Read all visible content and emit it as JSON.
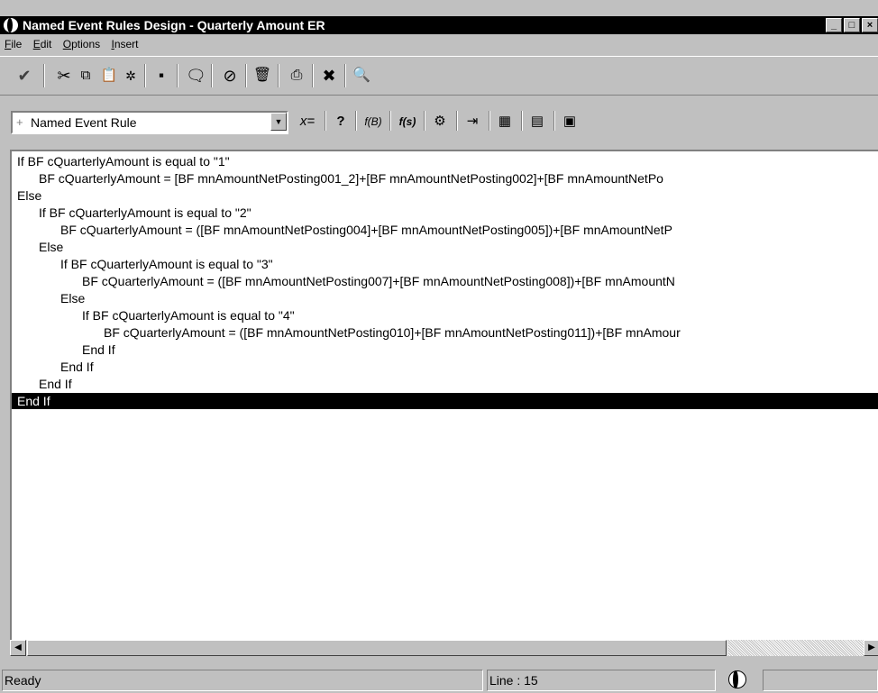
{
  "window": {
    "title": "Named Event Rules Design - Quarterly Amount ER"
  },
  "menu": {
    "items": [
      {
        "key": "F",
        "rest": "ile"
      },
      {
        "key": "E",
        "rest": "dit"
      },
      {
        "key": "O",
        "rest": "ptions"
      },
      {
        "key": "I",
        "rest": "nsert"
      }
    ]
  },
  "toolbar": {
    "icons": [
      "checkmark-icon",
      "cut-icon",
      "copy-icon",
      "paste-icon",
      "find-replace-icon",
      "save-icon",
      "comment-icon",
      "cancel-icon",
      "delete-icon",
      "print-icon",
      "close-icon",
      "validate-icon"
    ]
  },
  "er_toolbar": {
    "selector_value": "Named Event Rule",
    "selector_prefix": "+",
    "assignment_label": "x=",
    "if_label": "?",
    "function_b_label": "f(B)",
    "function_s_label": "f(s)"
  },
  "editor": {
    "lines": [
      {
        "indent": 0,
        "text": "If BF cQuarterlyAmount is equal to \"1\"",
        "selected": false
      },
      {
        "indent": 1,
        "text": "BF cQuarterlyAmount = [BF mnAmountNetPosting001_2]+[BF mnAmountNetPosting002]+[BF mnAmountNetPo",
        "selected": false
      },
      {
        "indent": 0,
        "text": "Else",
        "selected": false
      },
      {
        "indent": 1,
        "text": "If BF cQuarterlyAmount is equal to \"2\"",
        "selected": false
      },
      {
        "indent": 2,
        "text": "BF cQuarterlyAmount = ([BF mnAmountNetPosting004]+[BF mnAmountNetPosting005])+[BF mnAmountNetP",
        "selected": false
      },
      {
        "indent": 1,
        "text": "Else",
        "selected": false
      },
      {
        "indent": 2,
        "text": "If BF cQuarterlyAmount is equal to \"3\"",
        "selected": false
      },
      {
        "indent": 3,
        "text": "BF cQuarterlyAmount = ([BF mnAmountNetPosting007]+[BF mnAmountNetPosting008])+[BF mnAmountN",
        "selected": false
      },
      {
        "indent": 2,
        "text": "Else",
        "selected": false
      },
      {
        "indent": 3,
        "text": "If BF cQuarterlyAmount is equal to \"4\"",
        "selected": false
      },
      {
        "indent": 4,
        "text": "BF cQuarterlyAmount = ([BF mnAmountNetPosting010]+[BF mnAmountNetPosting011])+[BF mnAmour",
        "selected": false
      },
      {
        "indent": 3,
        "text": "End If",
        "selected": false
      },
      {
        "indent": 2,
        "text": "End If",
        "selected": false
      },
      {
        "indent": 1,
        "text": "End If",
        "selected": false
      },
      {
        "indent": 0,
        "text": "End If",
        "selected": true
      }
    ]
  },
  "status": {
    "message": "Ready",
    "line_label": "Line : 15"
  }
}
